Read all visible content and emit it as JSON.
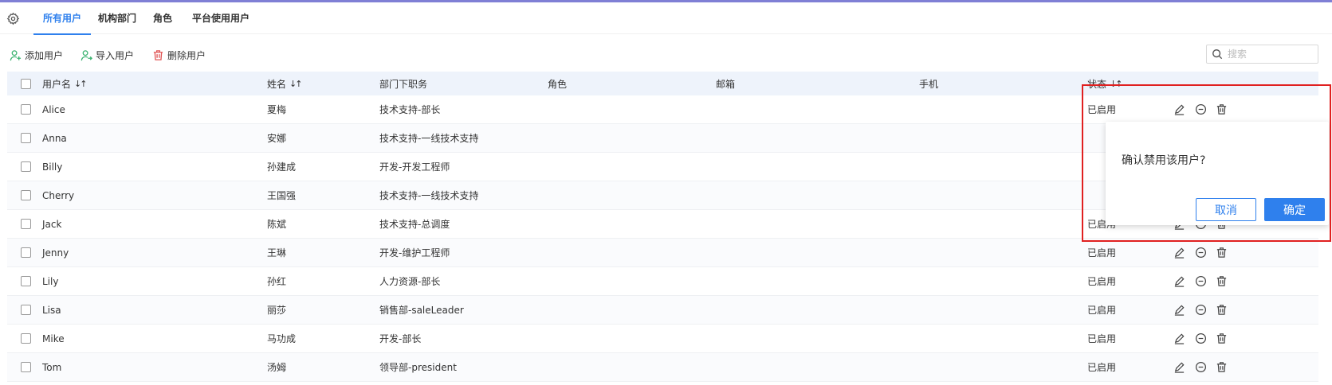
{
  "tabs": [
    {
      "label": "所有用户",
      "active": true
    },
    {
      "label": "机构部门"
    },
    {
      "label": "角色"
    },
    {
      "label": "平台使用用户"
    }
  ],
  "toolbar": {
    "add_label": "添加用户",
    "import_label": "导入用户",
    "delete_label": "删除用户"
  },
  "search": {
    "placeholder": "搜索",
    "value": ""
  },
  "columns": {
    "username": "用户名",
    "name": "姓名",
    "department": "部门下职务",
    "role": "角色",
    "email": "邮箱",
    "phone": "手机",
    "status": "状态"
  },
  "rows": [
    {
      "username": "Alice",
      "name": "夏梅",
      "department": "技术支持-部长",
      "role": "",
      "email": "",
      "phone": "",
      "status": "已启用"
    },
    {
      "username": "Anna",
      "name": "安娜",
      "department": "技术支持-一线技术支持",
      "role": "",
      "email": "",
      "phone": "",
      "status": ""
    },
    {
      "username": "Billy",
      "name": "孙建成",
      "department": "开发-开发工程师",
      "role": "",
      "email": "",
      "phone": "",
      "status": ""
    },
    {
      "username": "Cherry",
      "name": "王国强",
      "department": "技术支持-一线技术支持",
      "role": "",
      "email": "",
      "phone": "",
      "status": ""
    },
    {
      "username": "Jack",
      "name": "陈斌",
      "department": "技术支持-总调度",
      "role": "",
      "email": "",
      "phone": "",
      "status": "已启用"
    },
    {
      "username": "Jenny",
      "name": "王琳",
      "department": "开发-维护工程师",
      "role": "",
      "email": "",
      "phone": "",
      "status": "已启用"
    },
    {
      "username": "Lily",
      "name": "孙红",
      "department": "人力资源-部长",
      "role": "",
      "email": "",
      "phone": "",
      "status": "已启用"
    },
    {
      "username": "Lisa",
      "name": "丽莎",
      "department": "销售部-saleLeader",
      "role": "",
      "email": "",
      "phone": "",
      "status": "已启用"
    },
    {
      "username": "Mike",
      "name": "马功成",
      "department": "开发-部长",
      "role": "",
      "email": "",
      "phone": "",
      "status": "已启用"
    },
    {
      "username": "Tom",
      "name": "汤姆",
      "department": "领导部-president",
      "role": "",
      "email": "",
      "phone": "",
      "status": "已启用"
    }
  ],
  "popover": {
    "message": "确认禁用该用户?",
    "cancel_label": "取消",
    "ok_label": "确定"
  },
  "colors": {
    "accent": "#2f80ed",
    "header_bg": "#eef3fb",
    "highlight": "#e02020",
    "add_icon": "#3cb371",
    "delete_icon": "#e05555"
  },
  "icons": {
    "settings": "gear-icon",
    "add": "add-user-icon",
    "import": "import-user-icon",
    "delete": "trash-icon",
    "search": "search-icon",
    "edit": "pencil-icon",
    "disable": "minus-circle-icon",
    "remove": "trash-icon"
  }
}
